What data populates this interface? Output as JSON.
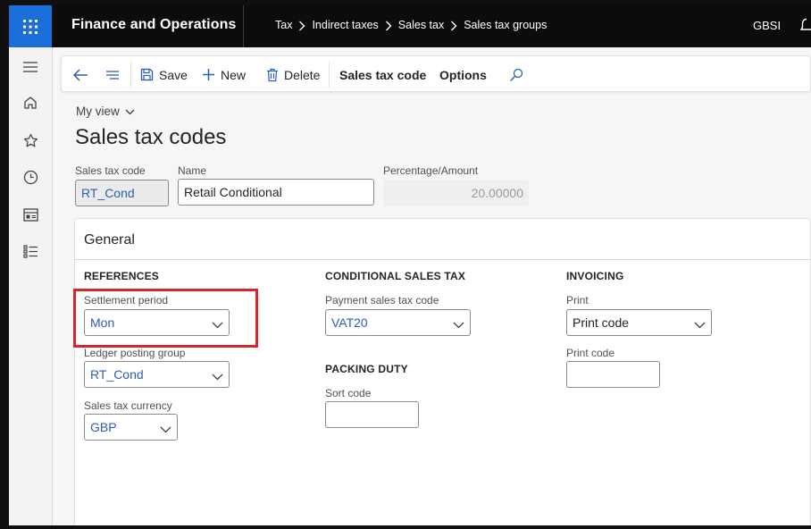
{
  "app": {
    "title": "Finance and Operations",
    "company": "GBSI"
  },
  "breadcrumb": [
    "Tax",
    "Indirect taxes",
    "Sales tax",
    "Sales tax groups"
  ],
  "toolbar": {
    "save_label": "Save",
    "new_label": "New",
    "delete_label": "Delete",
    "sales_tax_code_label": "Sales tax code",
    "options_label": "Options"
  },
  "view": {
    "my_view_label": "My view",
    "page_title": "Sales tax codes"
  },
  "header_fields": {
    "code_label": "Sales tax code",
    "code_value": "RT_Cond",
    "name_label": "Name",
    "name_value": "Retail Conditional",
    "percentage_label": "Percentage/Amount",
    "percentage_value": "20.00000"
  },
  "general": {
    "title": "General",
    "references": {
      "heading": "REFERENCES",
      "settlement_period_label": "Settlement period",
      "settlement_period_value": "Mon",
      "ledger_posting_group_label": "Ledger posting group",
      "ledger_posting_group_value": "RT_Cond",
      "currency_label": "Sales tax currency",
      "currency_value": "GBP"
    },
    "conditional": {
      "heading": "CONDITIONAL SALES TAX",
      "payment_code_label": "Payment sales tax code",
      "payment_code_value": "VAT20"
    },
    "packing": {
      "heading": "PACKING DUTY",
      "sort_code_label": "Sort code",
      "sort_code_value": ""
    },
    "invoicing": {
      "heading": "INVOICING",
      "print_label": "Print",
      "print_value": "Print code",
      "print_code_label": "Print code",
      "print_code_value": ""
    }
  },
  "colors": {
    "accent": "#1c6fd8",
    "link_text": "#2b5eb8",
    "highlight": "#d8262b"
  },
  "icons": [
    "waffle-icon",
    "chevron-right-icon",
    "bell-icon",
    "hamburger-icon",
    "home-icon",
    "star-icon",
    "clock-icon",
    "workspace-icon",
    "list-icon",
    "back-arrow-icon",
    "lines-icon",
    "save-icon",
    "plus-icon",
    "trash-icon",
    "search-icon",
    "chevron-down-icon"
  ]
}
